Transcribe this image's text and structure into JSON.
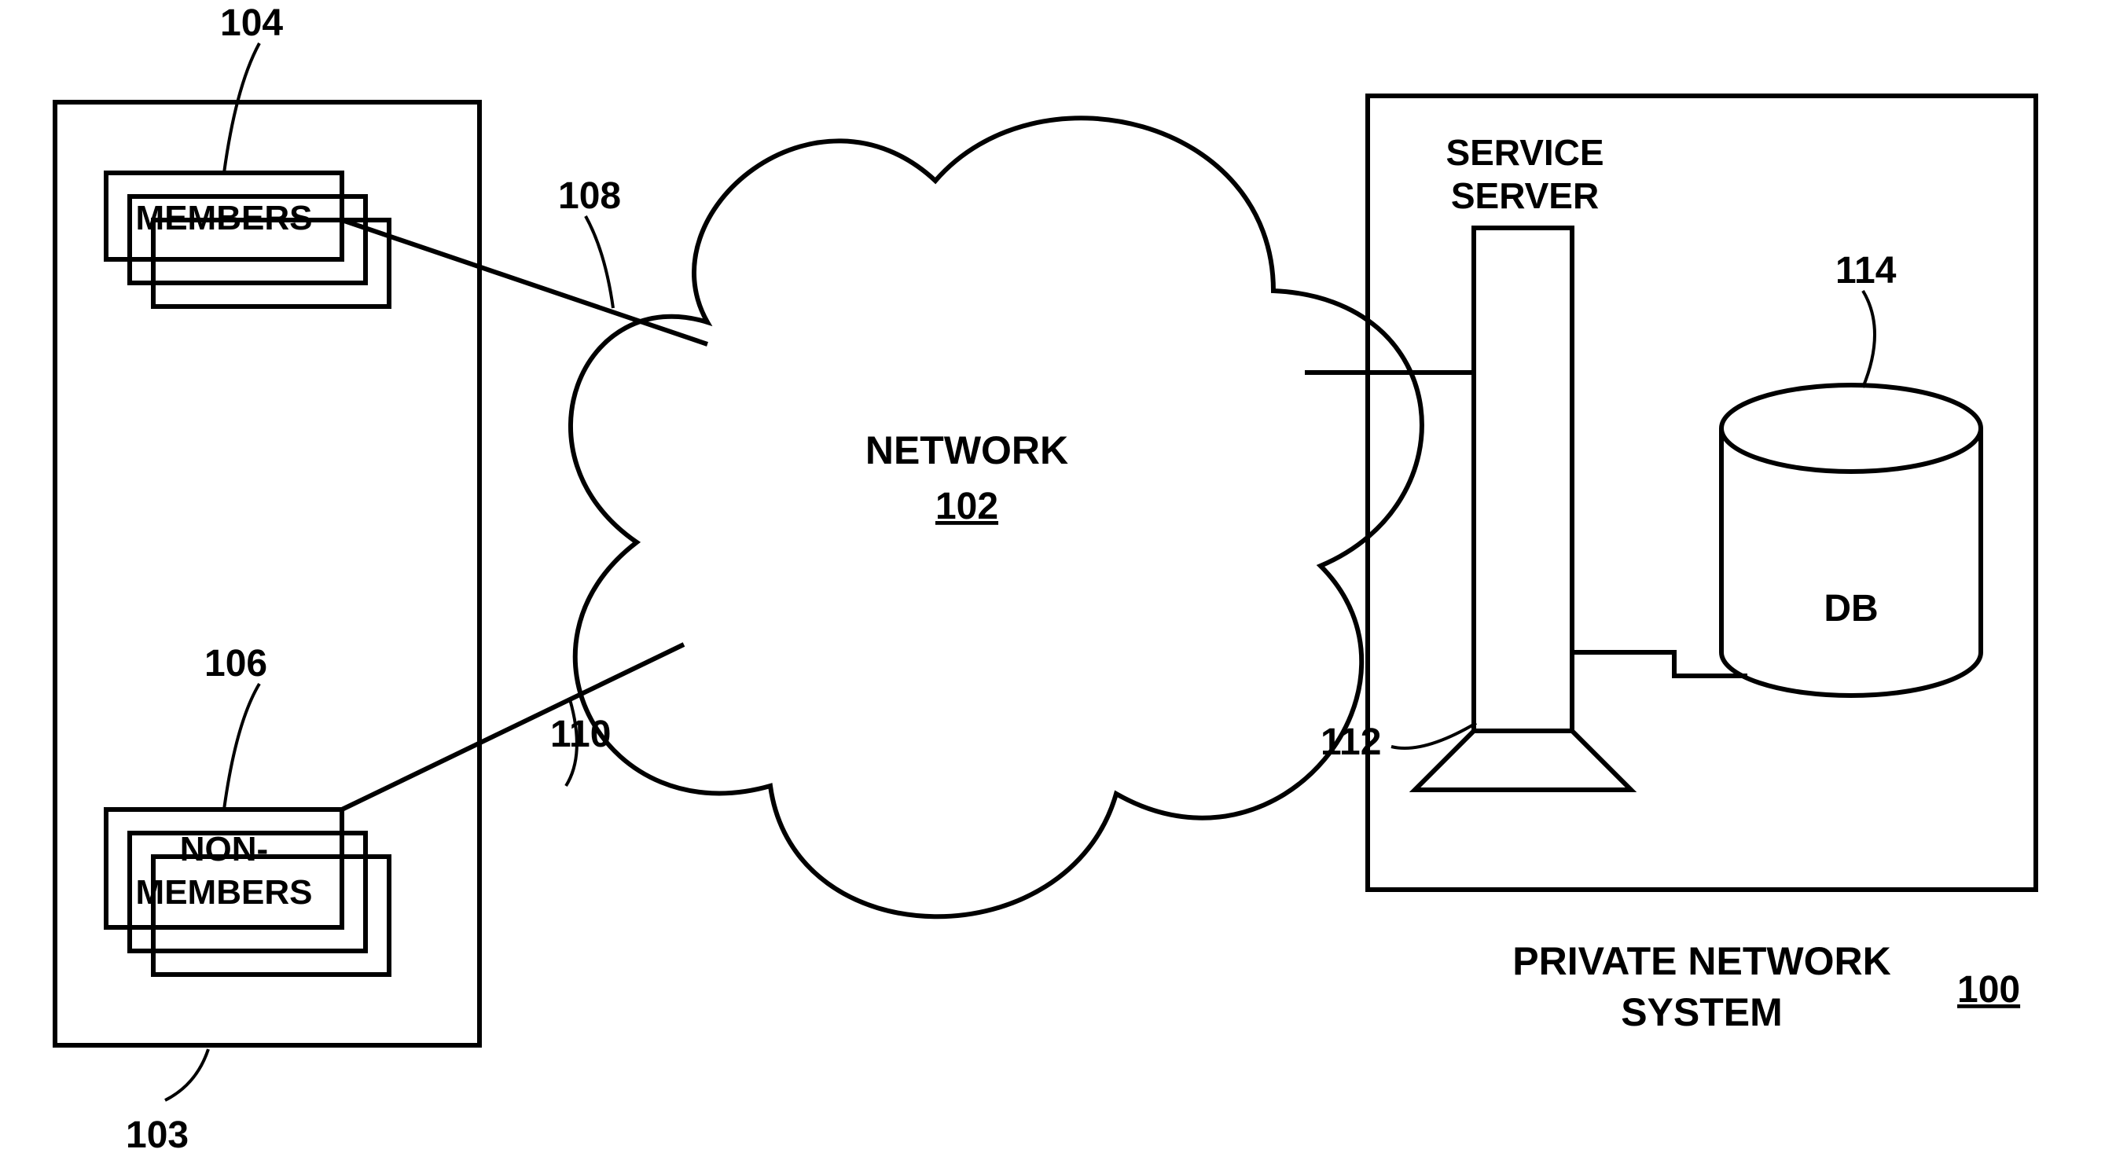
{
  "diagram": {
    "refs": {
      "r100": "100",
      "r102": "102",
      "r103": "103",
      "r104": "104",
      "r106": "106",
      "r108": "108",
      "r110": "110",
      "r112": "112",
      "r114": "114"
    },
    "labels": {
      "members": "MEMBERS",
      "nonmembers_l1": "NON-",
      "nonmembers_l2": "MEMBERS",
      "network": "NETWORK",
      "service_l1": "SERVICE",
      "service_l2": "SERVER",
      "db": "DB",
      "pns_l1": "PRIVATE NETWORK",
      "pns_l2": "SYSTEM"
    }
  }
}
